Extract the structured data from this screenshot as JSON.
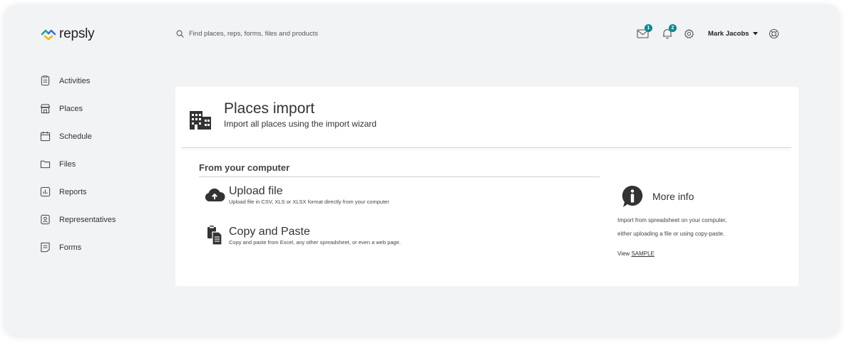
{
  "app": {
    "logo_text": "repsly",
    "brand_colors": {
      "teal": "#1aa3a3",
      "yellow": "#f2b705",
      "blue": "#3b6ed8",
      "badge": "#0b8a8a"
    }
  },
  "header": {
    "search": {
      "placeholder": "Find places, reps, forms, files and products",
      "value": ""
    },
    "icons": [
      {
        "name": "mail-icon",
        "badge": "1"
      },
      {
        "name": "bell-icon",
        "badge": "2"
      },
      {
        "name": "gear-icon"
      }
    ],
    "user": {
      "name": "Mark Jacobs"
    },
    "help_icon": "lifebuoy-icon"
  },
  "sidebar": {
    "items": [
      {
        "label": "Activities",
        "icon": "clipboard-icon"
      },
      {
        "label": "Places",
        "icon": "storefront-icon"
      },
      {
        "label": "Schedule",
        "icon": "calendar-icon"
      },
      {
        "label": "Files",
        "icon": "folder-icon"
      },
      {
        "label": "Reports",
        "icon": "chart-icon"
      },
      {
        "label": "Representatives",
        "icon": "id-badge-icon"
      },
      {
        "label": "Forms",
        "icon": "form-icon"
      }
    ]
  },
  "main": {
    "title": "Places import",
    "subtitle": "Import all places using the import wizard",
    "section_title": "From your computer",
    "options": [
      {
        "title": "Upload file",
        "description": "Upload file in CSV, XLS or XLSX format directly from your computer",
        "icon": "cloud-upload-icon"
      },
      {
        "title": "Copy and Paste",
        "description": "Copy and paste from Excel, any other spreadsheet, or even a web page.",
        "icon": "copy-paste-icon"
      }
    ],
    "info": {
      "title": "More info",
      "text_line1": "Import from spreadsheet on your computer,",
      "text_line2": "either uploading a file or using copy-paste.",
      "link_prefix": "View",
      "link_label": "SAMPLE"
    }
  }
}
